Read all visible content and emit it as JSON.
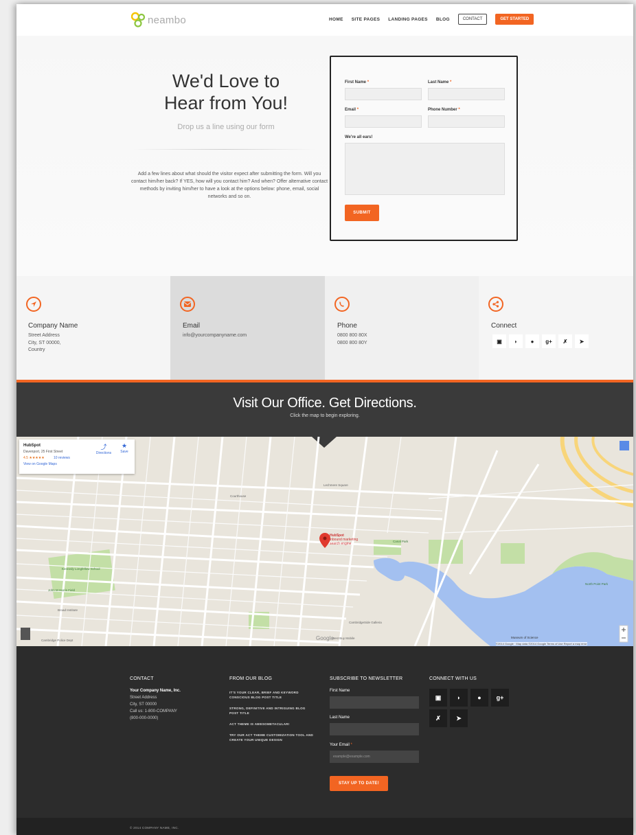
{
  "header": {
    "logo_text": "neambo",
    "nav": [
      "HOME",
      "SITE PAGES",
      "LANDING PAGES",
      "BLOG"
    ],
    "contact_label": "CONTACT",
    "cta_label": "GET STARTED"
  },
  "hero": {
    "title_line1": "We'd Love to",
    "title_line2": "Hear from You!",
    "subtitle": "Drop us a line using our form",
    "body": "Add a few lines about what should the visitor expect after submitting the form. Will you contact him/her back? If YES, how will you contact him? And when? Offer alternative contact methods by inviting him/her to have a look at the options below: phone, email, social networks and so on."
  },
  "form": {
    "first_name_label": "First Name",
    "last_name_label": "Last Name",
    "email_label": "Email",
    "phone_label": "Phone Number",
    "message_label": "We're all ears!",
    "required_mark": "*",
    "submit_label": "SUBMIT"
  },
  "info": {
    "company": {
      "title": "Company Name",
      "line1": "Street Address",
      "line2": "City, ST 00000,",
      "line3": "Country"
    },
    "email": {
      "title": "Email",
      "line1": "info@yourcompanyname.com"
    },
    "phone": {
      "title": "Phone",
      "line1": "0800 800 80X",
      "line2": "0800 800 80Y"
    },
    "connect": {
      "title": "Connect"
    }
  },
  "visit": {
    "title": "Visit Our Office. Get Directions.",
    "subtitle": "Click the map to begin exploring."
  },
  "map": {
    "card_title": "HubSpot",
    "card_address": "Davenport, 25 First Street",
    "card_rating": "4.5 ★★★★★",
    "card_reviews": "10 reviews",
    "card_link": "View on Google Maps",
    "directions_label": "Directions",
    "save_label": "Save",
    "pin_title": "HubSpot",
    "pin_sub1": "inbound marketing",
    "pin_sub2": "search engine",
    "labels": {
      "lechmere": "Lechmere Square",
      "courthouse": "Courthouse",
      "canal": "Canal Park",
      "cambridgeside": "CambridgeSide Galleria",
      "museum": "Museum of Science",
      "kennedy": "Kennedy Longfellow School",
      "john_m": "John M Harris Field",
      "broad": "Broad Institute",
      "police": "Cambridge Police Dept",
      "north_point": "North Point Park",
      "google": "Google",
      "best_buy": "Best Buy Mobile",
      "attribution": "©2014 Google · Map data ©2014 Google  Terms of Use  Report a map error"
    }
  },
  "footer": {
    "contact_head": "CONTACT",
    "company": "Your Company Name, Inc.",
    "address1": "Street Address",
    "address2": "City, ST 00000",
    "phone1": "Call us: 1-800-COMPANY",
    "phone2": "(800-000-0000)",
    "blog_head": "FROM OUR BLOG",
    "blog_posts": [
      "IT'S YOUR CLEAR, BRIEF AND KEYWORD CONSCIOUS BLOG POST TITLE",
      "STRONG, DEFINITIVE AND INTRIGUING BLOG POST TITLE",
      "ACT THEME IS AWESOMETACULAR!",
      "TRY OUR ACT THEME CUSTOMIZATION TOOL AND CREATE YOUR UNIQUE DESIGN"
    ],
    "newsletter_head": "SUBSCRIBE TO NEWSLETTER",
    "nl_first": "First Name",
    "nl_last": "Last Name",
    "nl_email": "Your Email",
    "nl_placeholder": "example@example.com",
    "nl_button": "STAY UP TO DATE!",
    "connect_head": "CONNECT WITH US",
    "copyright": "© 2014 COMPANY NAME, INC."
  },
  "colors": {
    "accent": "#f26522",
    "dark": "#2c2c2c"
  }
}
